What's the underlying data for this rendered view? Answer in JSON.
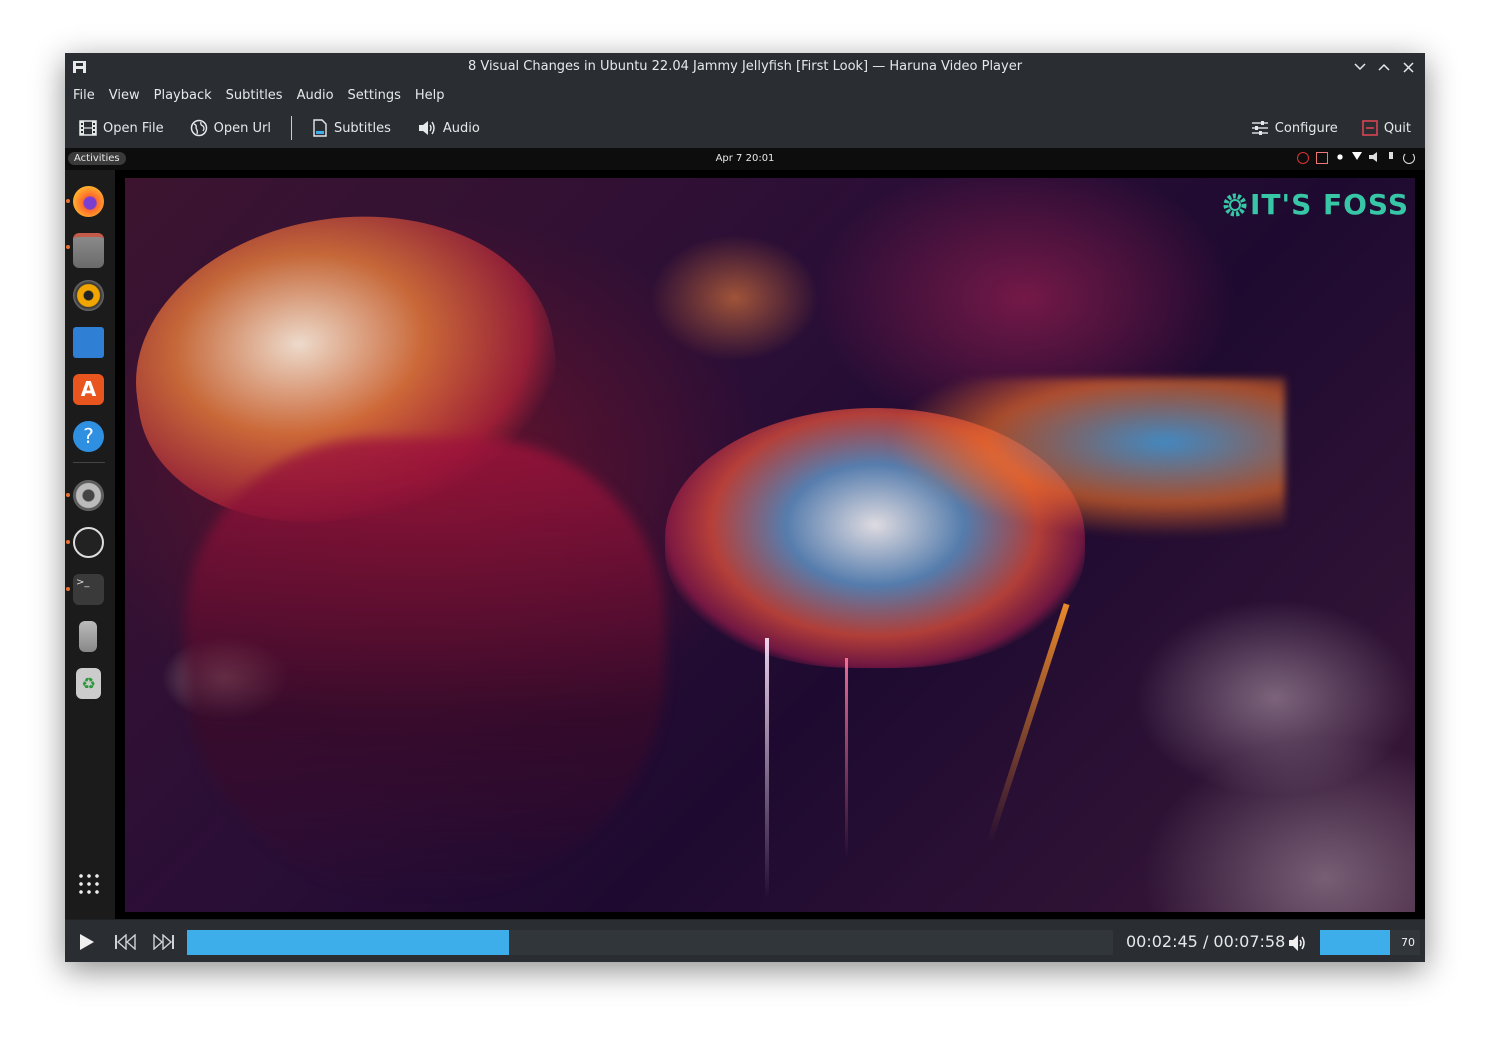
{
  "window": {
    "title": "8 Visual Changes in Ubuntu 22.04 Jammy Jellyfish [First Look] — Haruna Video Player"
  },
  "menu": [
    "File",
    "View",
    "Playback",
    "Subtitles",
    "Audio",
    "Settings",
    "Help"
  ],
  "toolbar": {
    "open_file": "Open File",
    "open_url": "Open Url",
    "subtitles": "Subtitles",
    "audio": "Audio",
    "configure": "Configure",
    "quit": "Quit"
  },
  "video": {
    "desktop_activities": "Activities",
    "desktop_clock": "Apr 7  20:01",
    "watermark": "IT'S FOSS",
    "dock_apps": [
      "firefox-icon",
      "files-icon",
      "rhythmbox-icon",
      "writer-icon",
      "software-icon",
      "help-icon",
      "settings-icon",
      "obs-icon",
      "terminal-icon",
      "usb-icon",
      "trash-icon",
      "app-grid-icon"
    ]
  },
  "player": {
    "time_display": "00:02:45 / 00:07:58",
    "progress_fraction": 0.348,
    "volume": "70",
    "volume_fraction": 0.7
  },
  "colors": {
    "accent": "#3daee9",
    "background": "#2a2e32",
    "quit_icon": "#da4453"
  }
}
